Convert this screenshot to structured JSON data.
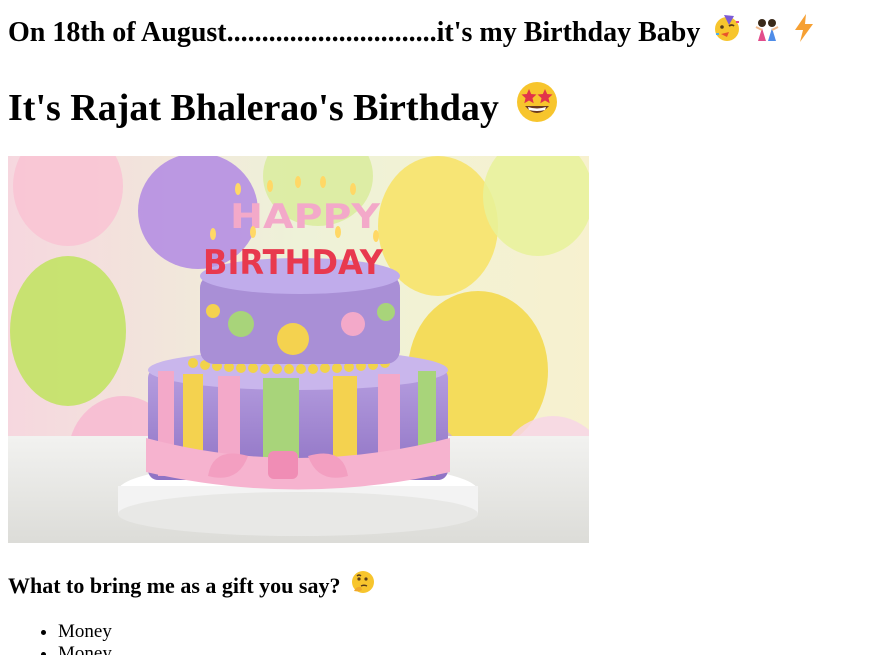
{
  "header": {
    "line1_text": "On 18th of August..............................it's my Birthday Baby",
    "line1_icons": [
      "partying-face-icon",
      "dancing-people-icon",
      "lightning-bolt-icon"
    ],
    "title_text": "It's Rajat Bhalerao's Birthday",
    "title_icon": "star-struck-face-icon"
  },
  "photo": {
    "cake_topper_letters_top": "HAPPY",
    "cake_topper_letters_bottom": "BIRTHDAY"
  },
  "gift_section": {
    "question": "What to bring me as a gift you say?",
    "question_icon": "thinking-face-icon",
    "items": [
      "Money",
      "Money"
    ]
  },
  "colors": {
    "text": "#000000",
    "background": "#ffffff",
    "cake_purple": "#a98fd6",
    "cake_pink": "#f3a9c9",
    "cake_yellow": "#f4d24f",
    "cake_green": "#a8d47a"
  }
}
